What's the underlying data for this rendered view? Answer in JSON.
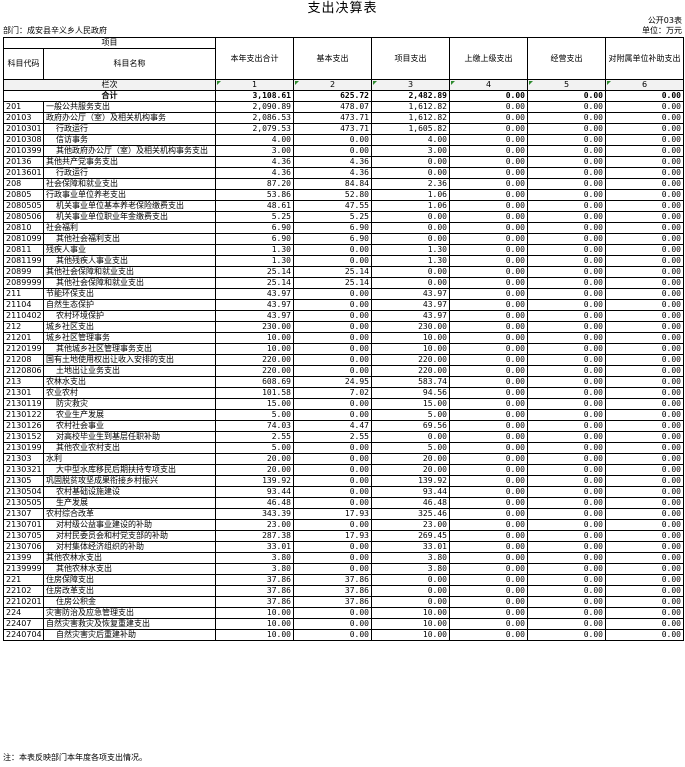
{
  "title": "支出决算表",
  "form_no": "公开03表",
  "dept": "部门：成安县辛义乡人民政府",
  "unit": "单位：万元",
  "headers": {
    "project": "项目",
    "code": "科目代码",
    "name": "科目名称",
    "total": "本年支出合计",
    "basic": "基本支出",
    "proj": "项目支出",
    "upper": "上缴上级支出",
    "oper": "经营支出",
    "sub": "对附属单位补助支出"
  },
  "seq": {
    "label": "栏次",
    "c1": "1",
    "c2": "2",
    "c3": "3",
    "c4": "4",
    "c5": "5",
    "c6": "6"
  },
  "total_row": {
    "label": "合计",
    "total": "3,108.61",
    "basic": "625.72",
    "proj": "2,482.89",
    "upper": "0.00",
    "oper": "0.00",
    "sub": "0.00"
  },
  "rows": [
    {
      "code": "201",
      "name": "一般公共服务支出",
      "total": "2,090.89",
      "basic": "478.07",
      "proj": "1,612.82",
      "upper": "0.00",
      "oper": "0.00",
      "sub": "0.00"
    },
    {
      "code": "20103",
      "name": "政府办公厅（室）及相关机构事务",
      "total": "2,086.53",
      "basic": "473.71",
      "proj": "1,612.82",
      "upper": "0.00",
      "oper": "0.00",
      "sub": "0.00"
    },
    {
      "code": "2010301",
      "name": "行政运行",
      "total": "2,079.53",
      "basic": "473.71",
      "proj": "1,605.82",
      "upper": "0.00",
      "oper": "0.00",
      "sub": "0.00"
    },
    {
      "code": "2010308",
      "name": "信访事务",
      "total": "4.00",
      "basic": "0.00",
      "proj": "4.00",
      "upper": "0.00",
      "oper": "0.00",
      "sub": "0.00"
    },
    {
      "code": "2010399",
      "name": "其他政府办公厅（室）及相关机构事务支出",
      "total": "3.00",
      "basic": "0.00",
      "proj": "3.00",
      "upper": "0.00",
      "oper": "0.00",
      "sub": "0.00"
    },
    {
      "code": "20136",
      "name": "其他共产党事务支出",
      "total": "4.36",
      "basic": "4.36",
      "proj": "0.00",
      "upper": "0.00",
      "oper": "0.00",
      "sub": "0.00"
    },
    {
      "code": "2013601",
      "name": "行政运行",
      "total": "4.36",
      "basic": "4.36",
      "proj": "0.00",
      "upper": "0.00",
      "oper": "0.00",
      "sub": "0.00"
    },
    {
      "code": "208",
      "name": "社会保障和就业支出",
      "total": "87.20",
      "basic": "84.84",
      "proj": "2.36",
      "upper": "0.00",
      "oper": "0.00",
      "sub": "0.00"
    },
    {
      "code": "20805",
      "name": "行政事业单位养老支出",
      "total": "53.86",
      "basic": "52.80",
      "proj": "1.06",
      "upper": "0.00",
      "oper": "0.00",
      "sub": "0.00"
    },
    {
      "code": "2080505",
      "name": "机关事业单位基本养老保险缴费支出",
      "total": "48.61",
      "basic": "47.55",
      "proj": "1.06",
      "upper": "0.00",
      "oper": "0.00",
      "sub": "0.00"
    },
    {
      "code": "2080506",
      "name": "机关事业单位职业年金缴费支出",
      "total": "5.25",
      "basic": "5.25",
      "proj": "0.00",
      "upper": "0.00",
      "oper": "0.00",
      "sub": "0.00"
    },
    {
      "code": "20810",
      "name": "社会福利",
      "total": "6.90",
      "basic": "6.90",
      "proj": "0.00",
      "upper": "0.00",
      "oper": "0.00",
      "sub": "0.00"
    },
    {
      "code": "2081099",
      "name": "其他社会福利支出",
      "total": "6.90",
      "basic": "6.90",
      "proj": "0.00",
      "upper": "0.00",
      "oper": "0.00",
      "sub": "0.00"
    },
    {
      "code": "20811",
      "name": "残疾人事业",
      "total": "1.30",
      "basic": "0.00",
      "proj": "1.30",
      "upper": "0.00",
      "oper": "0.00",
      "sub": "0.00"
    },
    {
      "code": "2081199",
      "name": "其他残疾人事业支出",
      "total": "1.30",
      "basic": "0.00",
      "proj": "1.30",
      "upper": "0.00",
      "oper": "0.00",
      "sub": "0.00"
    },
    {
      "code": "20899",
      "name": "其他社会保障和就业支出",
      "total": "25.14",
      "basic": "25.14",
      "proj": "0.00",
      "upper": "0.00",
      "oper": "0.00",
      "sub": "0.00"
    },
    {
      "code": "2089999",
      "name": "其他社会保障和就业支出",
      "total": "25.14",
      "basic": "25.14",
      "proj": "0.00",
      "upper": "0.00",
      "oper": "0.00",
      "sub": "0.00"
    },
    {
      "code": "211",
      "name": "节能环保支出",
      "total": "43.97",
      "basic": "0.00",
      "proj": "43.97",
      "upper": "0.00",
      "oper": "0.00",
      "sub": "0.00"
    },
    {
      "code": "21104",
      "name": "自然生态保护",
      "total": "43.97",
      "basic": "0.00",
      "proj": "43.97",
      "upper": "0.00",
      "oper": "0.00",
      "sub": "0.00"
    },
    {
      "code": "2110402",
      "name": "农村环境保护",
      "total": "43.97",
      "basic": "0.00",
      "proj": "43.97",
      "upper": "0.00",
      "oper": "0.00",
      "sub": "0.00"
    },
    {
      "code": "212",
      "name": "城乡社区支出",
      "total": "230.00",
      "basic": "0.00",
      "proj": "230.00",
      "upper": "0.00",
      "oper": "0.00",
      "sub": "0.00"
    },
    {
      "code": "21201",
      "name": "城乡社区管理事务",
      "total": "10.00",
      "basic": "0.00",
      "proj": "10.00",
      "upper": "0.00",
      "oper": "0.00",
      "sub": "0.00"
    },
    {
      "code": "2120199",
      "name": "其他城乡社区管理事务支出",
      "total": "10.00",
      "basic": "0.00",
      "proj": "10.00",
      "upper": "0.00",
      "oper": "0.00",
      "sub": "0.00"
    },
    {
      "code": "21208",
      "name": "国有土地使用权出让收入安排的支出",
      "total": "220.00",
      "basic": "0.00",
      "proj": "220.00",
      "upper": "0.00",
      "oper": "0.00",
      "sub": "0.00"
    },
    {
      "code": "2120806",
      "name": "土地出让业务支出",
      "total": "220.00",
      "basic": "0.00",
      "proj": "220.00",
      "upper": "0.00",
      "oper": "0.00",
      "sub": "0.00"
    },
    {
      "code": "213",
      "name": "农林水支出",
      "total": "608.69",
      "basic": "24.95",
      "proj": "583.74",
      "upper": "0.00",
      "oper": "0.00",
      "sub": "0.00"
    },
    {
      "code": "21301",
      "name": "农业农村",
      "total": "101.58",
      "basic": "7.02",
      "proj": "94.56",
      "upper": "0.00",
      "oper": "0.00",
      "sub": "0.00"
    },
    {
      "code": "2130119",
      "name": "防灾救灾",
      "total": "15.00",
      "basic": "0.00",
      "proj": "15.00",
      "upper": "0.00",
      "oper": "0.00",
      "sub": "0.00"
    },
    {
      "code": "2130122",
      "name": "农业生产发展",
      "total": "5.00",
      "basic": "0.00",
      "proj": "5.00",
      "upper": "0.00",
      "oper": "0.00",
      "sub": "0.00"
    },
    {
      "code": "2130126",
      "name": "农村社会事业",
      "total": "74.03",
      "basic": "4.47",
      "proj": "69.56",
      "upper": "0.00",
      "oper": "0.00",
      "sub": "0.00"
    },
    {
      "code": "2130152",
      "name": "对高校毕业生到基层任职补助",
      "total": "2.55",
      "basic": "2.55",
      "proj": "0.00",
      "upper": "0.00",
      "oper": "0.00",
      "sub": "0.00"
    },
    {
      "code": "2130199",
      "name": "其他农业农村支出",
      "total": "5.00",
      "basic": "0.00",
      "proj": "5.00",
      "upper": "0.00",
      "oper": "0.00",
      "sub": "0.00"
    },
    {
      "code": "21303",
      "name": "水利",
      "total": "20.00",
      "basic": "0.00",
      "proj": "20.00",
      "upper": "0.00",
      "oper": "0.00",
      "sub": "0.00"
    },
    {
      "code": "2130321",
      "name": "大中型水库移民后期扶持专项支出",
      "total": "20.00",
      "basic": "0.00",
      "proj": "20.00",
      "upper": "0.00",
      "oper": "0.00",
      "sub": "0.00"
    },
    {
      "code": "21305",
      "name": "巩固脱贫攻坚成果衔接乡村振兴",
      "total": "139.92",
      "basic": "0.00",
      "proj": "139.92",
      "upper": "0.00",
      "oper": "0.00",
      "sub": "0.00"
    },
    {
      "code": "2130504",
      "name": "农村基础设施建设",
      "total": "93.44",
      "basic": "0.00",
      "proj": "93.44",
      "upper": "0.00",
      "oper": "0.00",
      "sub": "0.00"
    },
    {
      "code": "2130505",
      "name": "生产发展",
      "total": "46.48",
      "basic": "0.00",
      "proj": "46.48",
      "upper": "0.00",
      "oper": "0.00",
      "sub": "0.00"
    },
    {
      "code": "21307",
      "name": "农村综合改革",
      "total": "343.39",
      "basic": "17.93",
      "proj": "325.46",
      "upper": "0.00",
      "oper": "0.00",
      "sub": "0.00"
    },
    {
      "code": "2130701",
      "name": "对村级公益事业建设的补助",
      "total": "23.00",
      "basic": "0.00",
      "proj": "23.00",
      "upper": "0.00",
      "oper": "0.00",
      "sub": "0.00"
    },
    {
      "code": "2130705",
      "name": "对村民委员会和村党支部的补助",
      "total": "287.38",
      "basic": "17.93",
      "proj": "269.45",
      "upper": "0.00",
      "oper": "0.00",
      "sub": "0.00"
    },
    {
      "code": "2130706",
      "name": "对村集体经济组织的补助",
      "total": "33.01",
      "basic": "0.00",
      "proj": "33.01",
      "upper": "0.00",
      "oper": "0.00",
      "sub": "0.00"
    },
    {
      "code": "21399",
      "name": "其他农林水支出",
      "total": "3.80",
      "basic": "0.00",
      "proj": "3.80",
      "upper": "0.00",
      "oper": "0.00",
      "sub": "0.00"
    },
    {
      "code": "2139999",
      "name": "其他农林水支出",
      "total": "3.80",
      "basic": "0.00",
      "proj": "3.80",
      "upper": "0.00",
      "oper": "0.00",
      "sub": "0.00"
    },
    {
      "code": "221",
      "name": "住房保障支出",
      "total": "37.86",
      "basic": "37.86",
      "proj": "0.00",
      "upper": "0.00",
      "oper": "0.00",
      "sub": "0.00"
    },
    {
      "code": "22102",
      "name": "住房改革支出",
      "total": "37.86",
      "basic": "37.86",
      "proj": "0.00",
      "upper": "0.00",
      "oper": "0.00",
      "sub": "0.00"
    },
    {
      "code": "2210201",
      "name": "住房公积金",
      "total": "37.86",
      "basic": "37.86",
      "proj": "0.00",
      "upper": "0.00",
      "oper": "0.00",
      "sub": "0.00"
    },
    {
      "code": "224",
      "name": "灾害防治及应急管理支出",
      "total": "10.00",
      "basic": "0.00",
      "proj": "10.00",
      "upper": "0.00",
      "oper": "0.00",
      "sub": "0.00"
    },
    {
      "code": "22407",
      "name": "自然灾害救灾及恢复重建支出",
      "total": "10.00",
      "basic": "0.00",
      "proj": "10.00",
      "upper": "0.00",
      "oper": "0.00",
      "sub": "0.00"
    },
    {
      "code": "2240704",
      "name": "自然灾害灾后重建补助",
      "total": "10.00",
      "basic": "0.00",
      "proj": "10.00",
      "upper": "0.00",
      "oper": "0.00",
      "sub": "0.00"
    }
  ],
  "note": "注：本表反映部门本年度各项支出情况。"
}
